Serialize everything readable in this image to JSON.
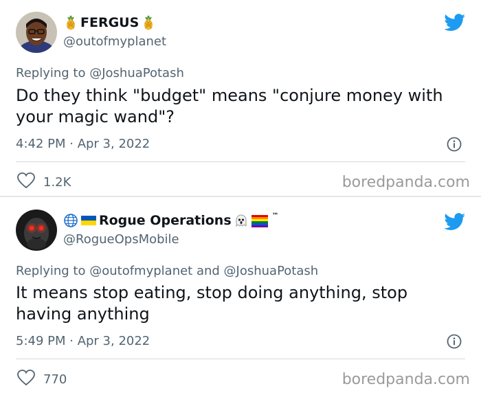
{
  "tweets": [
    {
      "display_name": "FERGUS",
      "handle": "@outofmyplanet",
      "replying_prefix": "Replying to",
      "replying_mentions": "@JoshuaPotash",
      "text": "Do they think \"budget\" means \"conjure money with your magic wand\"?",
      "timestamp": "4:42 PM · Apr 3, 2022",
      "likes": "1.2K",
      "icons": [
        "avatar",
        "pineapple-icon",
        "twitter-bird-icon",
        "info-icon",
        "heart-icon"
      ]
    },
    {
      "display_name": "Rogue Operations",
      "handle": "@RogueOpsMobile",
      "replying_prefix": "Replying to",
      "replying_mentions": "@outofmyplanet and @JoshuaPotash",
      "text": "It means stop eating, stop doing anything, stop having anything",
      "timestamp": "5:49 PM · Apr 3, 2022",
      "likes": "770",
      "trademark": "™",
      "icons": [
        "avatar",
        "globe-icon",
        "ukraine-flag-icon",
        "ghost-icon",
        "rainbow-flag-icon",
        "twitter-bird-icon",
        "info-icon",
        "heart-icon"
      ]
    }
  ],
  "watermark": "boredpanda.com",
  "colors": {
    "twitter_blue": "#1d9bf0",
    "text_primary": "#0f1419",
    "text_secondary": "#536471",
    "watermark": "#9a9a9a"
  }
}
